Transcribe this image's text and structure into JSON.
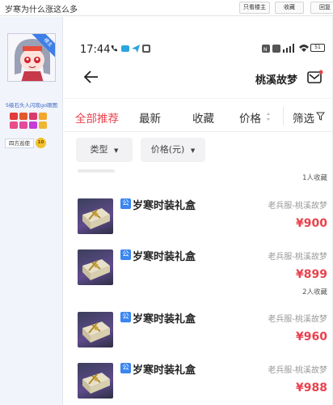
{
  "forum": {
    "title": "岁寒为什么涨这么多",
    "buttons": {
      "only_op": "只看楼主",
      "favorite": "收藏",
      "reply": "回复"
    }
  },
  "poster": {
    "avatar_badge": "楼主",
    "username": "5级石头人闪现go眼图",
    "role": "四方巡使",
    "level": "10"
  },
  "phone": {
    "status_bar": {
      "time": "17:44",
      "battery": "51"
    },
    "navbar": {
      "shop_name": "桃溪故梦"
    },
    "tabs": [
      {
        "label": "全部推荐",
        "active": true
      },
      {
        "label": "最新",
        "active": false
      },
      {
        "label": "收藏",
        "active": false
      },
      {
        "label": "价格",
        "active": false
      },
      {
        "label": "筛选",
        "active": false
      }
    ],
    "filters": {
      "type": "类型",
      "price": "价格(元)"
    },
    "listings": [
      {
        "collect_note": "1人收藏",
        "tag": "公",
        "name": "岁寒时装礼盒",
        "server": "老兵服-桃溪故梦",
        "price": "¥900"
      },
      {
        "collect_note": "",
        "tag": "公",
        "name": "岁寒时装礼盒",
        "server": "老兵服-桃溪故梦",
        "price": "¥899"
      },
      {
        "collect_note": "2人收藏",
        "tag": "公",
        "name": "岁寒时装礼盒",
        "server": "老兵服-桃溪故梦",
        "price": "¥960"
      },
      {
        "collect_note": "",
        "tag": "公",
        "name": "岁寒时装礼盒",
        "server": "老兵服-桃溪故梦",
        "price": "¥988"
      }
    ]
  },
  "colors": {
    "accent_red": "#e8424d",
    "gov_blue": "#3b86f0",
    "link_blue": "#3a66c4"
  }
}
